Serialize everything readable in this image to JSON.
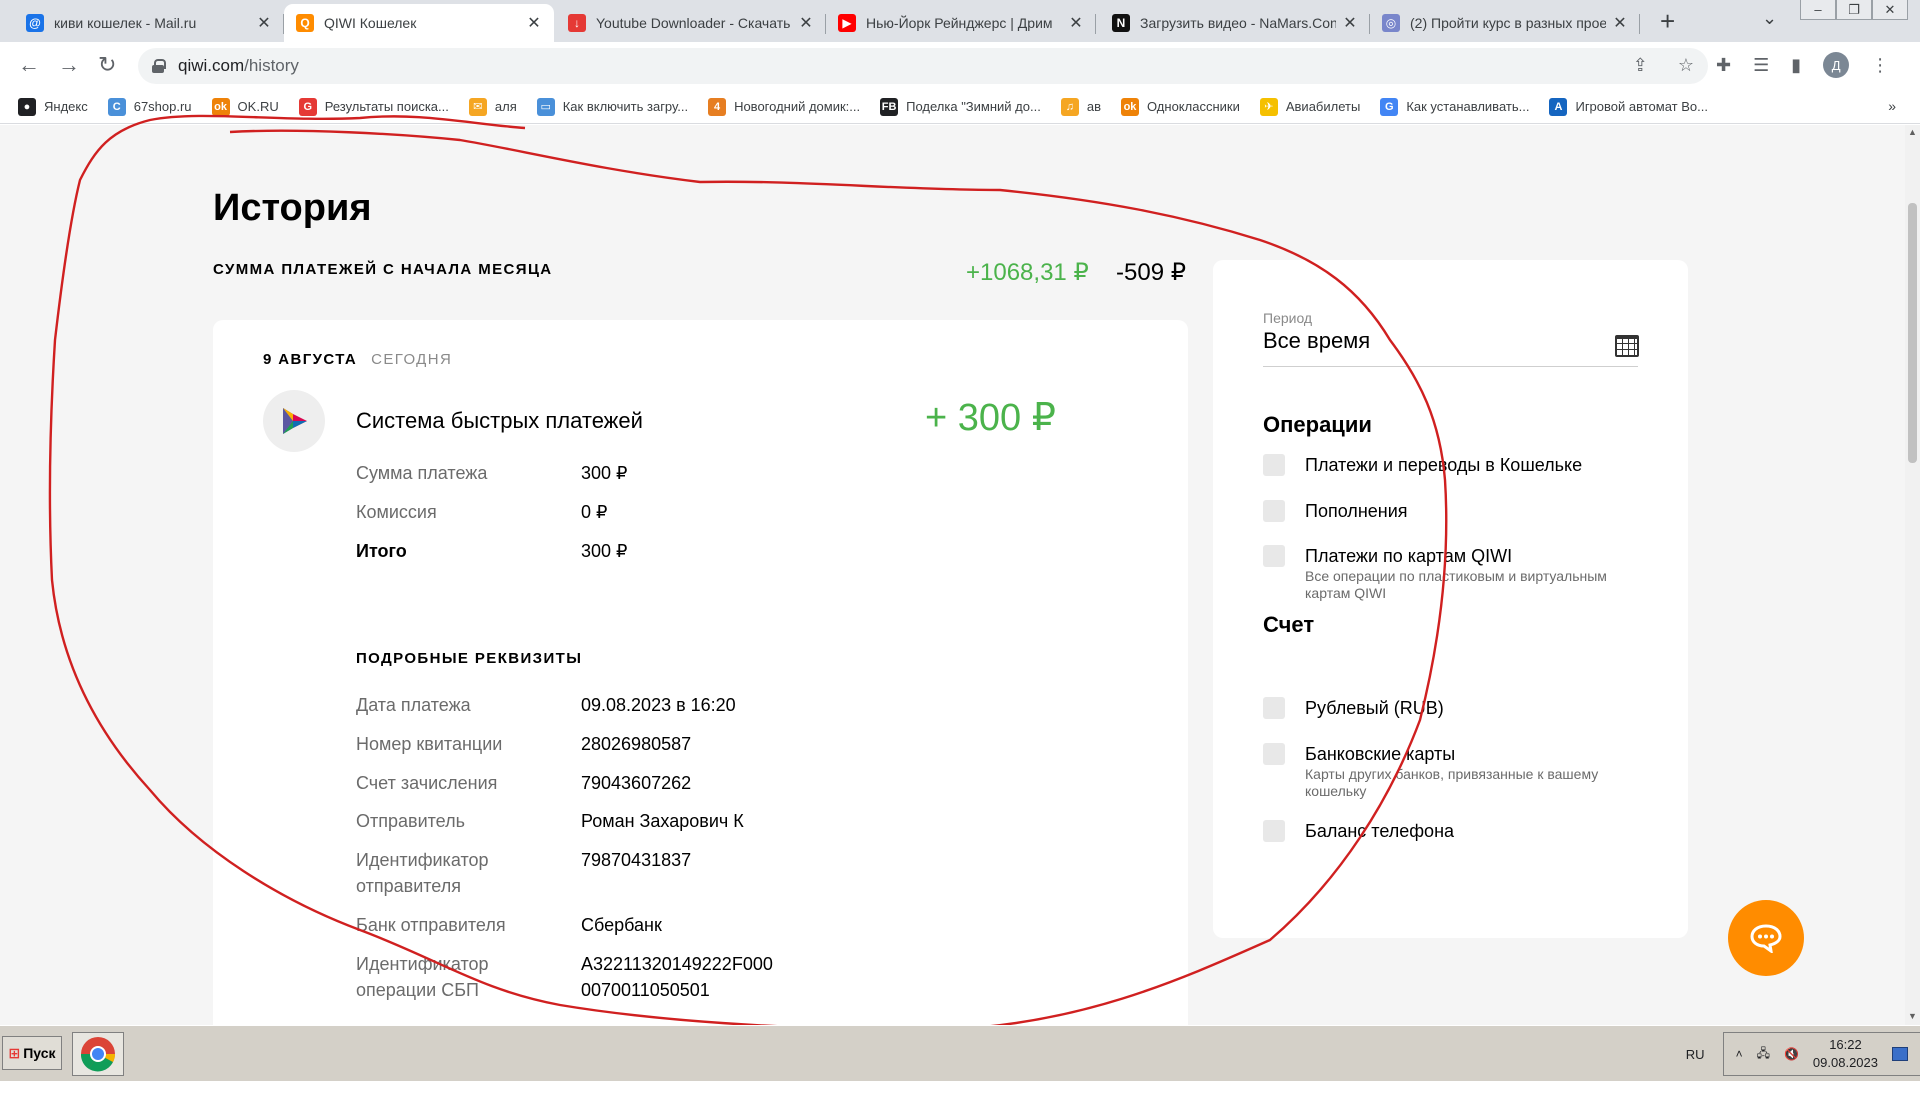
{
  "tabs": [
    {
      "title": "киви кошелек - Mail.ru",
      "icon": "@",
      "color": "#1a73e8",
      "active": false
    },
    {
      "title": "QIWI Кошелек",
      "icon": "Q",
      "color": "#ff8c00",
      "active": true
    },
    {
      "title": "Youtube Downloader - Скачать",
      "icon": "↓",
      "color": "#e53935",
      "active": false
    },
    {
      "title": "Нью-Йорк Рейнджерс | Дрим",
      "icon": "▶",
      "color": "#ff0000",
      "active": false
    },
    {
      "title": "Загрузить видео - NaMars.Con",
      "icon": "N",
      "color": "#111111",
      "active": false
    },
    {
      "title": "(2) Пройти курс в разных прое",
      "icon": "◎",
      "color": "#7986cb",
      "active": false
    }
  ],
  "tab_close": "✕",
  "new_tab": "+",
  "tab_search": "⌄",
  "window_controls": [
    "–",
    "❐",
    "✕"
  ],
  "nav": {
    "back": "←",
    "forward": "→",
    "reload": "↻"
  },
  "url": {
    "host": "qiwi.com",
    "path": "/history"
  },
  "omni_icons": [
    "share-icon",
    "star-icon"
  ],
  "omni_glyphs": {
    "share": "⇪",
    "star": "☆"
  },
  "toolbar_glyphs": {
    "extensions": "✚",
    "media": "☰",
    "sidepanel": "▮",
    "menu": "⋮"
  },
  "profile_initial": "Д",
  "bookmarks": [
    {
      "label": "Яндекс",
      "icon": "●",
      "color": "#202124"
    },
    {
      "label": "67shop.ru",
      "icon": "C",
      "color": "#4a90d9"
    },
    {
      "label": "OK.RU",
      "icon": "ok",
      "color": "#ee8208"
    },
    {
      "label": "Результаты поиска...",
      "icon": "G",
      "color": "#e53935"
    },
    {
      "label": "аля",
      "icon": "✉",
      "color": "#f5a623"
    },
    {
      "label": "Как включить загру...",
      "icon": "▭",
      "color": "#4a90d9"
    },
    {
      "label": "Новогодний домик:...",
      "icon": "4",
      "color": "#e67e22"
    },
    {
      "label": "Поделка \"Зимний до...",
      "icon": "FB",
      "color": "#202124"
    },
    {
      "label": "ав",
      "icon": "♫",
      "color": "#f5a623"
    },
    {
      "label": "Одноклассники",
      "icon": "ok",
      "color": "#ee8208"
    },
    {
      "label": "Авиабилеты",
      "icon": "✈",
      "color": "#f5c000"
    },
    {
      "label": "Как устанавливать...",
      "icon": "G",
      "color": "#4285f4"
    },
    {
      "label": "Игровой автомат Во...",
      "icon": "A",
      "color": "#1565c0"
    }
  ],
  "bookmarks_more": "»",
  "history": {
    "title": "История",
    "sum_label": "СУММА ПЛАТЕЖЕЙ С НАЧАЛА МЕСЯЦА",
    "sum_income": "+1068,31 ₽",
    "sum_expense": "-509 ₽"
  },
  "payment": {
    "date": "9 АВГУСТА",
    "day_label": "СЕГОДНЯ",
    "provider": "Система быстрых платежей",
    "amount": "+ 300 ₽",
    "summary": [
      {
        "k": "Сумма платежа",
        "v": "300 ₽",
        "bold": false
      },
      {
        "k": "Комиссия",
        "v": "0 ₽",
        "bold": false
      },
      {
        "k": "Итого",
        "v": "300 ₽",
        "bold": true
      }
    ],
    "details_label": "ПОДРОБНЫЕ РЕКВИЗИТЫ",
    "details": [
      {
        "k": "Дата платежа",
        "v": "09.08.2023 в 16:20"
      },
      {
        "k": "Номер квитанции",
        "v": "28026980587"
      },
      {
        "k": "Счет зачисления",
        "v": "79043607262"
      },
      {
        "k": "Отправитель",
        "v": "Роман Захарович К"
      },
      {
        "k": "Идентификатор отправителя",
        "v": "79870431837"
      },
      {
        "k": "Банк отправителя",
        "v": "Сбербанк"
      },
      {
        "k": "Идентификатор операции СБП",
        "v": "A32211320149222F000 0070011050501"
      }
    ]
  },
  "filter": {
    "period_label": "Период",
    "period_value": "Все время",
    "operations_title": "Операции",
    "operations": [
      {
        "label": "Платежи и переводы в Кошельке",
        "hint": ""
      },
      {
        "label": "Пополнения",
        "hint": ""
      },
      {
        "label": "Платежи по картам QIWI",
        "hint": "Все операции по пластиковым и виртуальным картам QIWI"
      }
    ],
    "account_title": "Счет",
    "accounts": [
      {
        "label": "Рублевый (RUB)",
        "hint": ""
      },
      {
        "label": "Банковские карты",
        "hint": "Карты других банков, привязанные к вашему кошельку"
      },
      {
        "label": "Баланс телефона",
        "hint": ""
      }
    ]
  },
  "colors": {
    "income": "#4bb34b",
    "accent": "#ff8c00",
    "scribble": "#d02020"
  },
  "taskbar": {
    "start": "Пуск",
    "lang": "RU",
    "tray_expand": "˄",
    "time": "16:22",
    "date": "09.08.2023"
  }
}
